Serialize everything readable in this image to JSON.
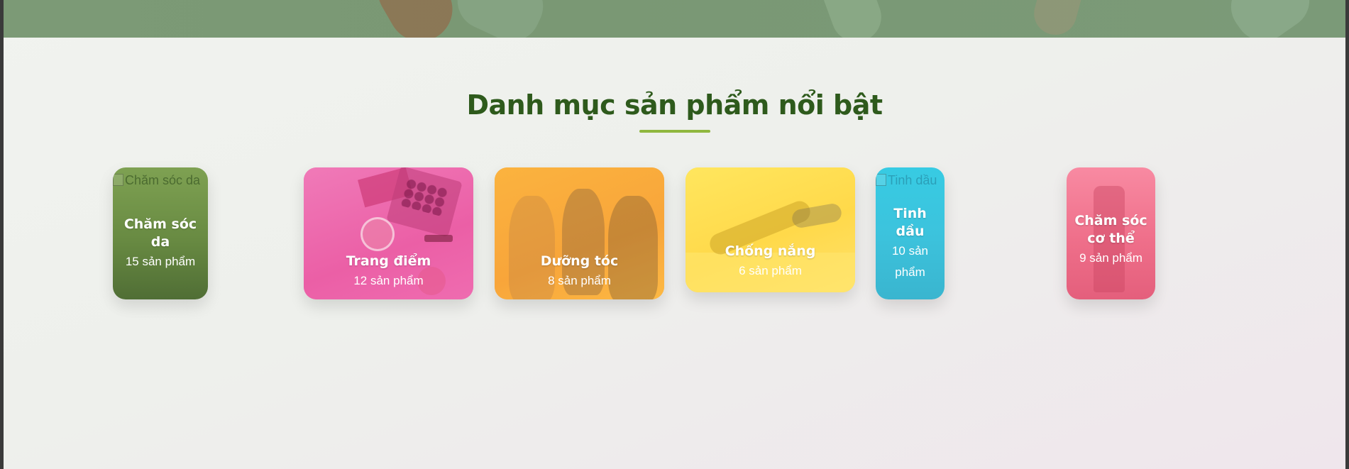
{
  "section": {
    "title": "Danh mục sản phẩm nổi bật",
    "accent_color": "#8fb73e",
    "title_color": "#2e5a1c"
  },
  "categories": [
    {
      "name": "Chăm sóc da",
      "count": "15 sản phẩm",
      "image_alt": "Chăm sóc da",
      "image_loaded": false,
      "color": "#6f9147"
    },
    {
      "name": "Trang điểm",
      "count": "12 sản phẩm",
      "image_loaded": true,
      "color": "#ec68ab"
    },
    {
      "name": "Dưỡng tóc",
      "count": "8 sản phẩm",
      "image_loaded": true,
      "color": "#f9a93a"
    },
    {
      "name": "Chống nắng",
      "count": "6 sản phẩm",
      "image_loaded": true,
      "color": "#ffd84a"
    },
    {
      "name": "Tinh dầu",
      "count": "10 sản phẩm",
      "image_alt": "Tinh dầu",
      "image_loaded": false,
      "color": "#3cc3dd"
    },
    {
      "name": "Chăm sóc cơ thể",
      "count": "9 sản phẩm",
      "image_loaded": true,
      "color": "#ef6f8a"
    }
  ]
}
